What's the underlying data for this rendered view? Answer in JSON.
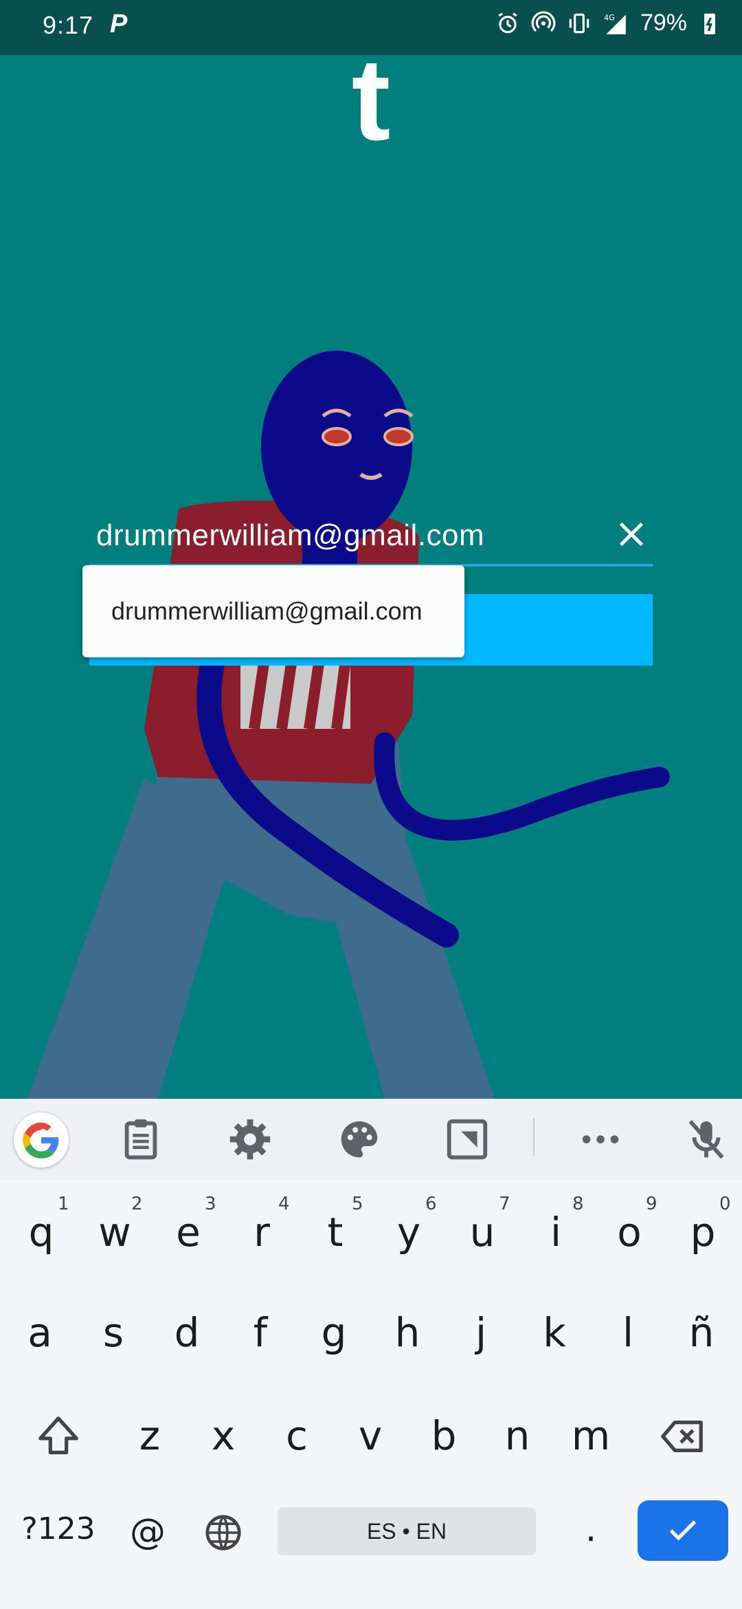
{
  "status_bar": {
    "time": "9:17",
    "app_icon": "P",
    "network": "4G",
    "battery": "79%"
  },
  "app": {
    "logo": "t",
    "email_value": "drummerwilliam@gmail.com",
    "autofill_suggestion": "drummerwilliam@gmail.com"
  },
  "keyboard": {
    "toolbar_icons": [
      "google-icon",
      "clipboard-icon",
      "settings-icon",
      "palette-icon",
      "translate-icon",
      "more-icon",
      "mic-off-icon"
    ],
    "row1": [
      {
        "key": "q",
        "hint": "1"
      },
      {
        "key": "w",
        "hint": "2"
      },
      {
        "key": "e",
        "hint": "3"
      },
      {
        "key": "r",
        "hint": "4"
      },
      {
        "key": "t",
        "hint": "5"
      },
      {
        "key": "y",
        "hint": "6"
      },
      {
        "key": "u",
        "hint": "7"
      },
      {
        "key": "i",
        "hint": "8"
      },
      {
        "key": "o",
        "hint": "9"
      },
      {
        "key": "p",
        "hint": "0"
      }
    ],
    "row2": [
      "a",
      "s",
      "d",
      "f",
      "g",
      "h",
      "j",
      "k",
      "l",
      "ñ"
    ],
    "row3": [
      "z",
      "x",
      "c",
      "v",
      "b",
      "n",
      "m"
    ],
    "symbols_label": "?123",
    "at_label": "@",
    "space_label": "ES • EN",
    "period_label": "."
  },
  "colors": {
    "background": "#017f7f",
    "accent": "#00b8ff",
    "enter_key": "#1a73e8"
  }
}
